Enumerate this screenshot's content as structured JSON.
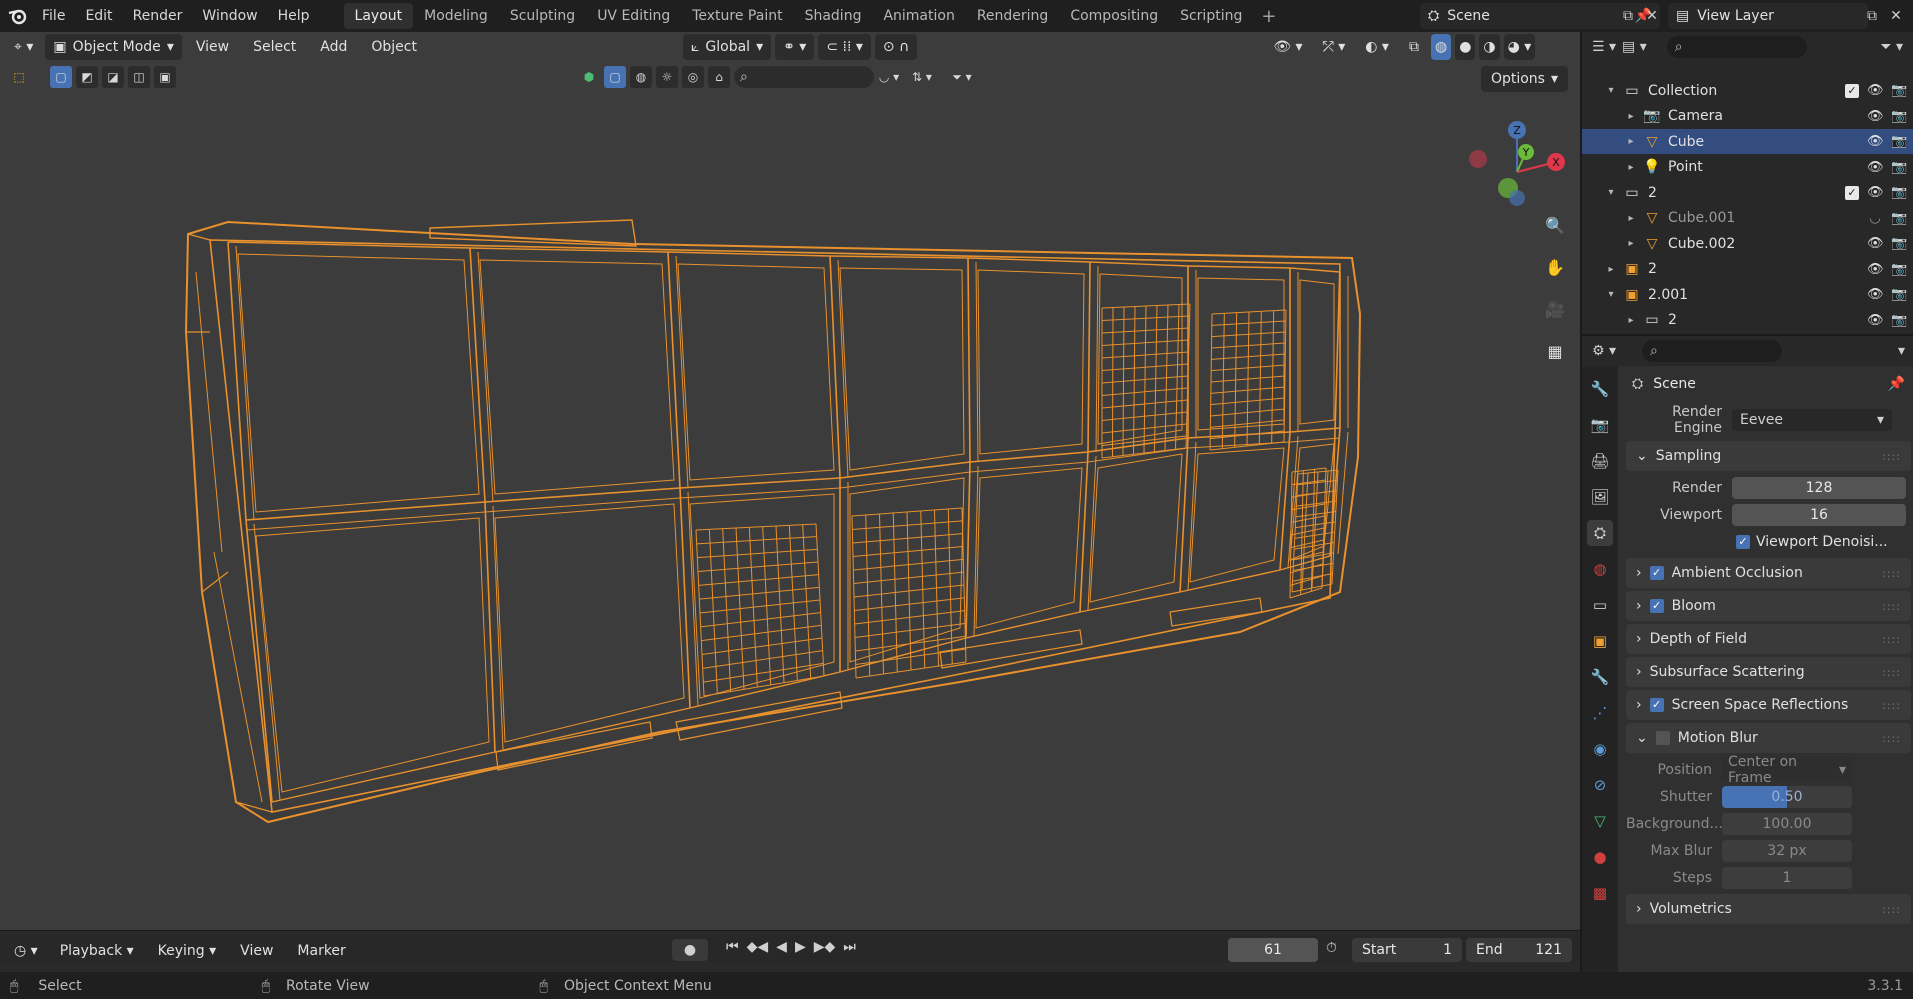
{
  "topbar": {
    "menus": [
      "File",
      "Edit",
      "Render",
      "Window",
      "Help"
    ],
    "workspaces": [
      "Layout",
      "Modeling",
      "Sculpting",
      "UV Editing",
      "Texture Paint",
      "Shading",
      "Animation",
      "Rendering",
      "Compositing",
      "Scripting"
    ],
    "active_workspace": "Layout",
    "add_tab": "+",
    "scene": "Scene",
    "view_layer": "View Layer"
  },
  "viewport": {
    "mode": "Object Mode",
    "menus": [
      "View",
      "Select",
      "Add",
      "Object"
    ],
    "transform_orientation": "Global",
    "options_label": "Options",
    "gizmo_axes": [
      "Z",
      "Y",
      "X"
    ],
    "wire_color": "#e8912d",
    "bg_color": "#3c3c3c"
  },
  "timeline": {
    "menus": [
      "Playback",
      "Keying",
      "View",
      "Marker"
    ],
    "current_frame": "61",
    "start_label": "Start",
    "start_value": "1",
    "end_label": "End",
    "end_value": "121"
  },
  "statusbar": {
    "hints": [
      "Select",
      "Rotate View",
      "Object Context Menu"
    ],
    "version": "3.3.1"
  },
  "outliner": {
    "rows": [
      {
        "name": "Collection",
        "icon": "collection-icon",
        "level": 1,
        "checkbox": true,
        "selected": false,
        "dim": false
      },
      {
        "name": "Camera",
        "icon": "camera-object-icon",
        "level": 2,
        "checkbox": false,
        "selected": false,
        "dim": false
      },
      {
        "name": "Cube",
        "icon": "mesh-object-icon",
        "level": 2,
        "checkbox": false,
        "selected": true,
        "dim": false
      },
      {
        "name": "Point",
        "icon": "light-object-icon",
        "level": 2,
        "checkbox": false,
        "selected": false,
        "dim": false
      },
      {
        "name": "2",
        "icon": "collection-icon",
        "level": 1,
        "checkbox": true,
        "selected": false,
        "dim": false
      },
      {
        "name": "Cube.001",
        "icon": "mesh-object-icon",
        "level": 2,
        "checkbox": false,
        "selected": false,
        "dim": true
      },
      {
        "name": "Cube.002",
        "icon": "mesh-object-icon",
        "level": 2,
        "checkbox": false,
        "selected": false,
        "dim": false
      },
      {
        "name": "2",
        "icon": "empty-object-icon",
        "level": 1,
        "checkbox": false,
        "selected": false,
        "dim": false
      },
      {
        "name": "2.001",
        "icon": "empty-object-icon",
        "level": 1,
        "checkbox": false,
        "selected": false,
        "dim": false
      },
      {
        "name": "2",
        "icon": "collection-instance-icon",
        "level": 2,
        "checkbox": false,
        "selected": false,
        "dim": false
      }
    ]
  },
  "properties": {
    "context": "Scene",
    "render_engine_label": "Render Engine",
    "render_engine": "Eevee",
    "sampling": {
      "title": "Sampling",
      "render_label": "Render",
      "render_value": "128",
      "viewport_label": "Viewport",
      "viewport_value": "16",
      "denoise_label": "Viewport Denoisi..."
    },
    "panels": [
      {
        "title": "Ambient Occlusion",
        "checkbox": true,
        "checked": true
      },
      {
        "title": "Bloom",
        "checkbox": true,
        "checked": true
      },
      {
        "title": "Depth of Field",
        "checkbox": false,
        "checked": false
      },
      {
        "title": "Subsurface Scattering",
        "checkbox": false,
        "checked": false
      },
      {
        "title": "Screen Space Reflections",
        "checkbox": true,
        "checked": true
      }
    ],
    "motion_blur": {
      "title": "Motion Blur",
      "position_label": "Position",
      "position_value": "Center on Frame",
      "shutter_label": "Shutter",
      "shutter_value": "0.50",
      "background_label": "Background...",
      "background_value": "100.00",
      "max_blur_label": "Max Blur",
      "max_blur_value": "32 px",
      "steps_label": "Steps",
      "steps_value": "1"
    },
    "volumetrics": "Volumetrics"
  }
}
